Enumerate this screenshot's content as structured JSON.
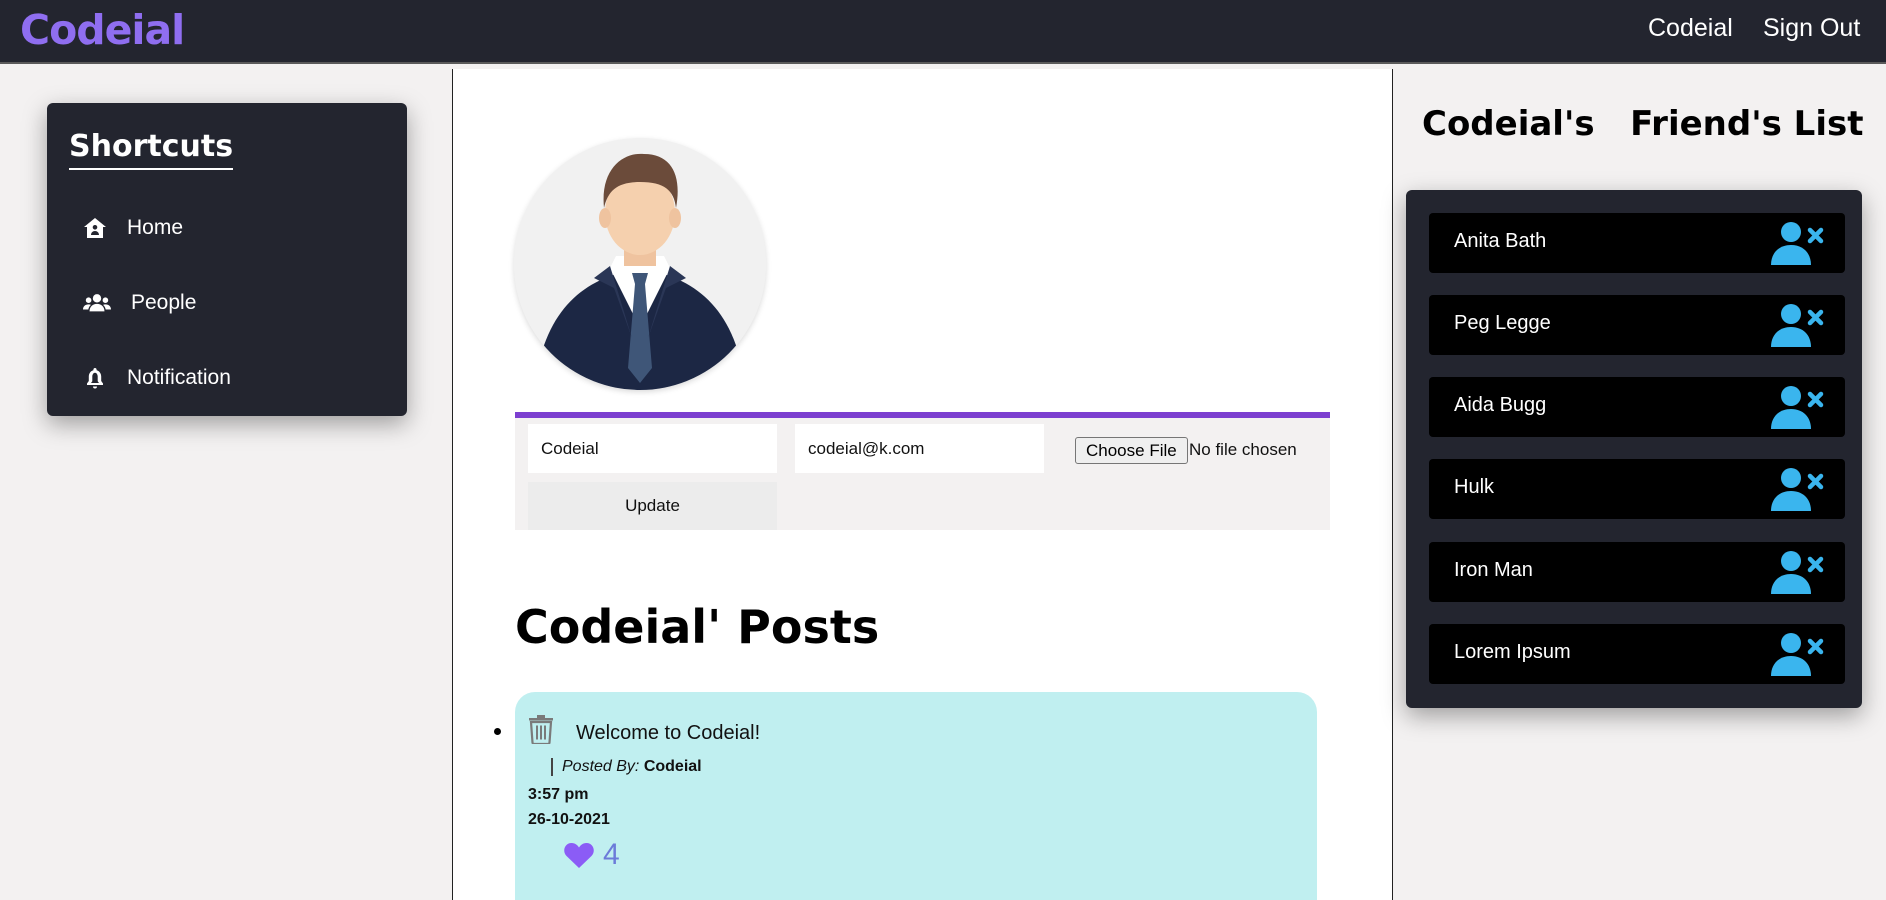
{
  "header": {
    "brand": "Codeial",
    "nav": [
      {
        "label": "Codeial"
      },
      {
        "label": "Sign Out"
      }
    ]
  },
  "shortcuts": {
    "title": "Shortcuts",
    "items": [
      {
        "label": "Home",
        "icon": "house-user-icon"
      },
      {
        "label": "People",
        "icon": "users-icon"
      },
      {
        "label": "Notification",
        "icon": "bell-icon"
      }
    ]
  },
  "profile": {
    "avatar": "businessman-avatar",
    "name_value": "Codeial",
    "email_value": "codeial@k.com",
    "file_button": "Choose File",
    "file_status": "No file chosen",
    "update_label": "Update",
    "accent_color": "#7c3fd0"
  },
  "posts": {
    "title": "Codeial' Posts",
    "items": [
      {
        "content": "Welcome to Codeial!",
        "posted_by_label": "Posted By:",
        "author": "Codeial",
        "time": "3:57 pm",
        "date": "26-10-2021",
        "likes": "4",
        "card_color": "#c0eff0"
      }
    ]
  },
  "friends": {
    "title_left": "Codeial's",
    "title_right": "Friend's List",
    "list": [
      {
        "name": "Anita Bath"
      },
      {
        "name": "Peg Legge"
      },
      {
        "name": "Aida Bugg"
      },
      {
        "name": "Hulk"
      },
      {
        "name": "Iron Man"
      },
      {
        "name": "Lorem Ipsum"
      }
    ],
    "icon_color": "#3ab5ee"
  }
}
